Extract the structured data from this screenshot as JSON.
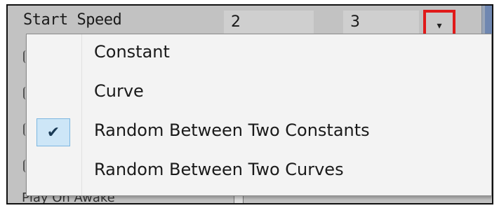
{
  "property_row": {
    "label": "Start Speed",
    "value_min": "2",
    "value_max": "3",
    "dropdown_icon": "▾"
  },
  "menu": {
    "items": [
      {
        "label": "Constant",
        "checked": false
      },
      {
        "label": "Curve",
        "checked": false
      },
      {
        "label": "Random Between Two Constants",
        "checked": true
      },
      {
        "label": "Random Between Two Curves",
        "checked": false
      }
    ],
    "check_icon": "✔"
  },
  "background": {
    "partial_label": "Play On Awake"
  },
  "colors": {
    "highlight_border": "#e01a1a",
    "selected_bg": "#cde6f7",
    "selected_border": "#7cb6e0"
  }
}
